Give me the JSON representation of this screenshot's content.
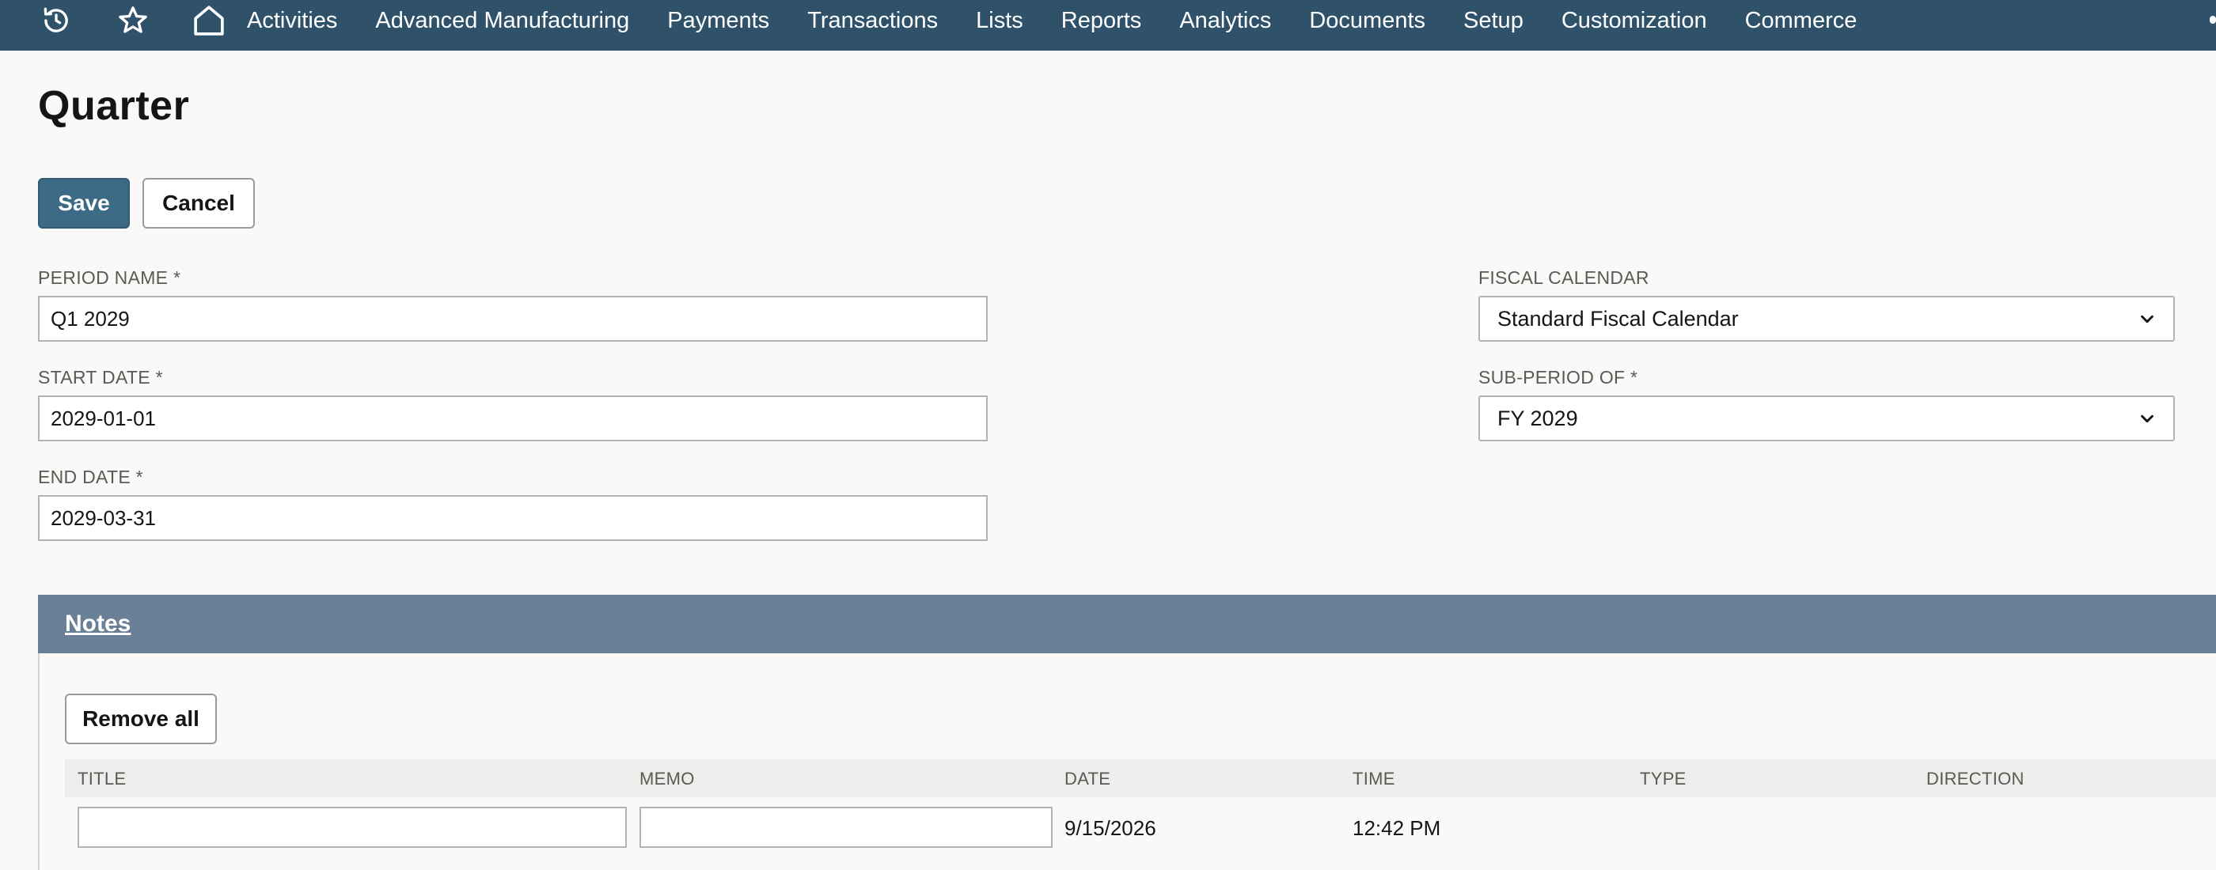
{
  "nav": {
    "icons": [
      "history-icon",
      "star-icon",
      "home-icon"
    ],
    "items": [
      "Activities",
      "Advanced Manufacturing",
      "Payments",
      "Transactions",
      "Lists",
      "Reports",
      "Analytics",
      "Documents",
      "Setup",
      "Customization",
      "Commerce"
    ]
  },
  "page": {
    "title": "Quarter"
  },
  "actions": {
    "save_label": "Save",
    "cancel_label": "Cancel"
  },
  "form": {
    "period_name": {
      "label": "PERIOD NAME *",
      "value": "Q1 2029"
    },
    "start_date": {
      "label": "START DATE *",
      "value": "2029-01-01"
    },
    "end_date": {
      "label": "END DATE *",
      "value": "2029-03-31"
    },
    "fiscal_calendar": {
      "label": "FISCAL CALENDAR",
      "value": "Standard Fiscal Calendar"
    },
    "sub_period_of": {
      "label": "SUB-PERIOD OF *",
      "value": "FY 2029"
    }
  },
  "notes": {
    "title": "Notes",
    "remove_all_label": "Remove all",
    "columns": [
      "TITLE",
      "MEMO",
      "DATE",
      "TIME",
      "TYPE",
      "DIRECTION"
    ],
    "new_row": {
      "title": "",
      "memo": "",
      "date": "9/15/2026",
      "time": "12:42 PM"
    }
  },
  "colors": {
    "nav_bg": "#2f526a",
    "primary_button": "#3d6b86",
    "section_header": "#6a8097",
    "page_bg": "#faf9f7"
  }
}
